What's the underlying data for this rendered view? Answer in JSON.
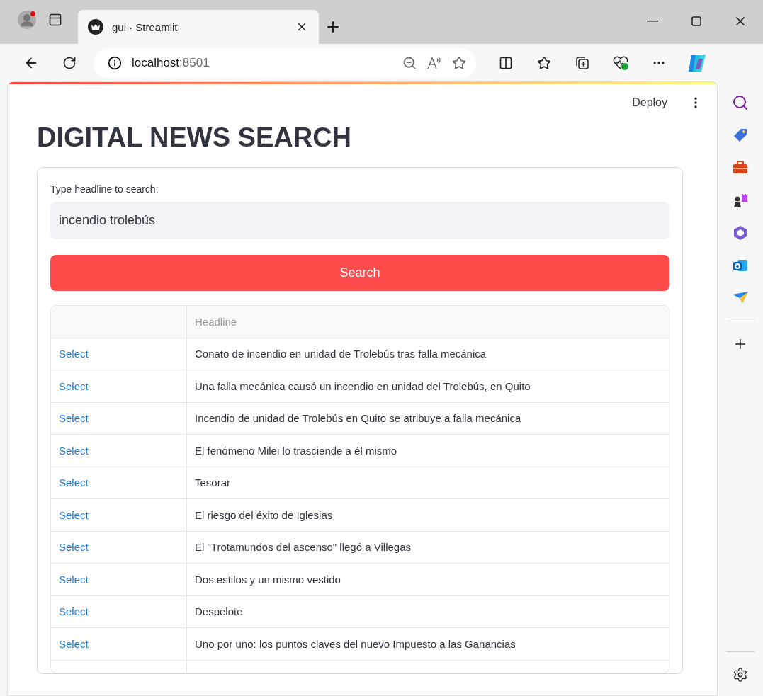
{
  "browser": {
    "tab_title": "gui · Streamlit",
    "address_host": "localhost",
    "address_port": ":8501"
  },
  "header": {
    "deploy": "Deploy"
  },
  "title": "DIGITAL NEWS SEARCH",
  "form": {
    "label": "Type headline to search:",
    "value": "incendio trolebús",
    "button": "Search"
  },
  "table": {
    "columns": [
      "",
      "Headline"
    ],
    "rows": [
      {
        "action": "Select",
        "headline": "Conato de incendio en unidad de Trolebús tras falla mecánica"
      },
      {
        "action": "Select",
        "headline": "Una falla mecánica causó un incendio en unidad del Trolebús, en Quito"
      },
      {
        "action": "Select",
        "headline": "Incendio de unidad de Trolebús en Quito se atribuye a falla mecánica"
      },
      {
        "action": "Select",
        "headline": "El fenómeno Milei lo trasciende a él mismo"
      },
      {
        "action": "Select",
        "headline": "Tesorar"
      },
      {
        "action": "Select",
        "headline": "El riesgo del éxito de Iglesias"
      },
      {
        "action": "Select",
        "headline": "El \"Trotamundos del ascenso\" llegó a Villegas"
      },
      {
        "action": "Select",
        "headline": "Dos estilos y un mismo vestido"
      },
      {
        "action": "Select",
        "headline": "Despelote"
      },
      {
        "action": "Select",
        "headline": "Uno por uno: los puntos claves del nuevo Impuesto a las Ganancias"
      }
    ]
  }
}
